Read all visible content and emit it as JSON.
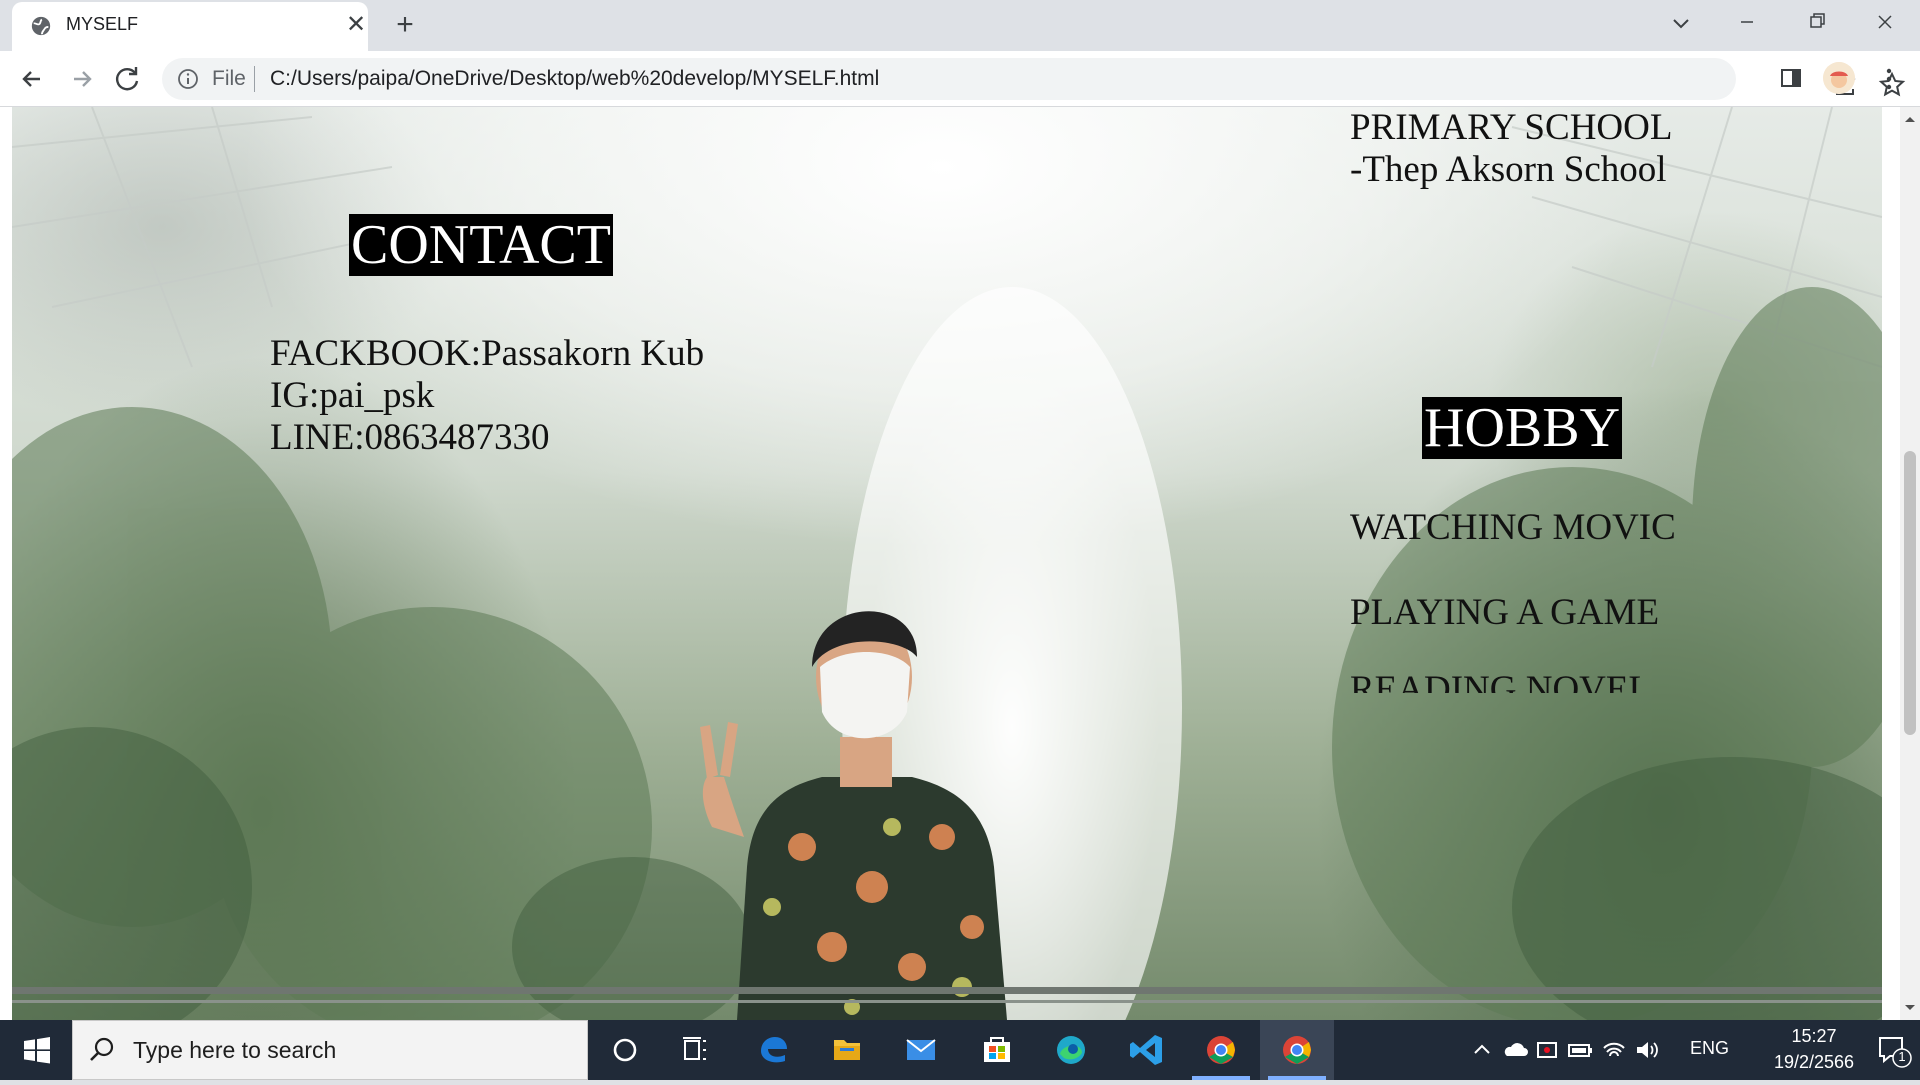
{
  "browser": {
    "tab": {
      "title": "MYSELF",
      "favicon": "globe-icon"
    },
    "address": {
      "security_label": "File",
      "url": "C:/Users/paipa/OneDrive/Desktop/web%20develop/MYSELF.html"
    }
  },
  "page": {
    "primary": {
      "heading": "PRIMARY SCHOOL",
      "school": "-Thep Aksorn School"
    },
    "contact": {
      "heading": "CONTACT",
      "facebook": "FACKBOOK:Passakorn Kub",
      "instagram": "IG:pai_psk",
      "line": "LINE:0863487330"
    },
    "hobby": {
      "heading": "HOBBY",
      "items": [
        "WATCHING MOVIC",
        "PLAYING A GAME",
        "READING NOVEL"
      ]
    }
  },
  "taskbar": {
    "search_placeholder": "Type here to search",
    "apps": [
      "cortana-icon",
      "task-view-icon",
      "edge-legacy-icon",
      "file-explorer-icon",
      "mail-icon",
      "store-icon",
      "edge-icon",
      "vscode-icon",
      "chrome-icon",
      "chrome-icon"
    ],
    "tray": {
      "language": "ENG",
      "time": "15:27",
      "date": "19/2/2566",
      "notifications": "1"
    }
  },
  "colors": {
    "heading_bg": "#000000",
    "heading_text": "#ffffff",
    "taskbar_bg": "#202a38"
  }
}
